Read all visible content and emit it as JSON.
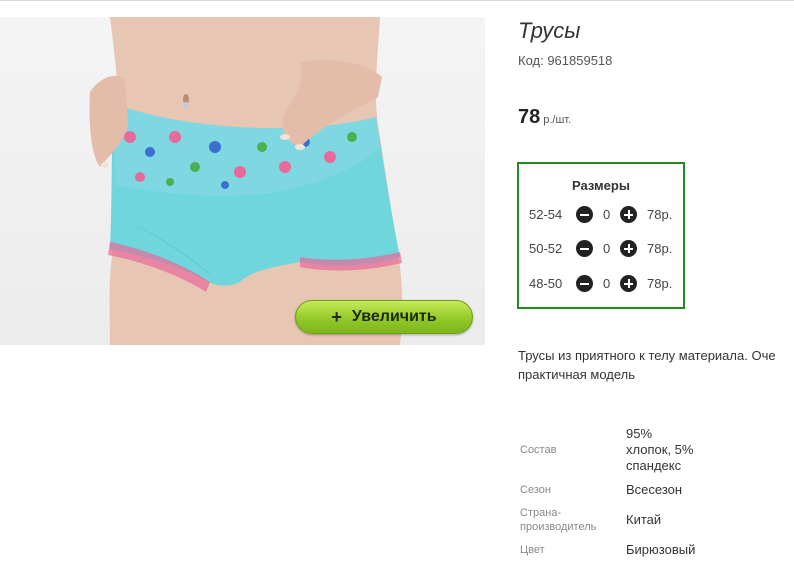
{
  "product": {
    "title": "Трусы",
    "code": "Код: 961859518",
    "price_value": "78",
    "price_unit": "р./шт.",
    "zoom_label": "Увеличить",
    "zoom_icon": "+",
    "image_icon": "product-photo"
  },
  "sizes": {
    "title": "Размеры",
    "rows": [
      {
        "label": "52-54",
        "qty": "0",
        "price": "78р."
      },
      {
        "label": "50-52",
        "qty": "0",
        "price": "78р."
      },
      {
        "label": "48-50",
        "qty": "0",
        "price": "78р."
      }
    ]
  },
  "description": {
    "line1": "Трусы из приятного к телу материала. Оче",
    "line2": "практичная модель"
  },
  "specs": [
    {
      "label": [
        "Состав"
      ],
      "value": [
        "95%",
        "хлопок, 5%",
        "спандекс"
      ]
    },
    {
      "label": [
        "Сезон"
      ],
      "value": [
        "Всесезон"
      ]
    },
    {
      "label": [
        "Страна-",
        "производитель"
      ],
      "value": [
        "Китай"
      ]
    },
    {
      "label": [
        "Цвет"
      ],
      "value": [
        "Бирюзовый"
      ]
    }
  ],
  "colors": {
    "frame_border": "#1f8a1f",
    "button_green": "#93c928",
    "garment": "#6fd6dc",
    "skin": "#e6c2b0"
  }
}
